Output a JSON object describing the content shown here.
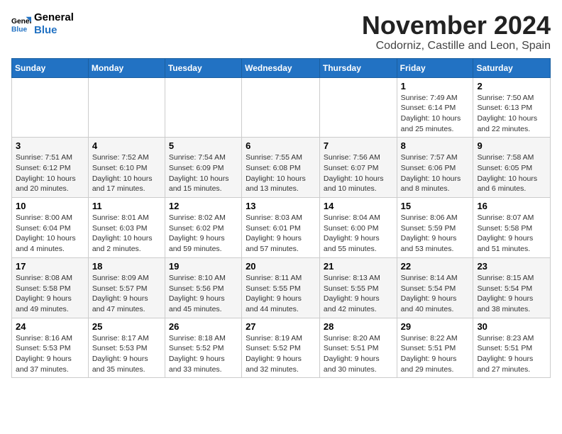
{
  "logo": {
    "line1": "General",
    "line2": "Blue"
  },
  "header": {
    "month_year": "November 2024",
    "location": "Codorniz, Castille and Leon, Spain"
  },
  "days_of_week": [
    "Sunday",
    "Monday",
    "Tuesday",
    "Wednesday",
    "Thursday",
    "Friday",
    "Saturday"
  ],
  "weeks": [
    [
      {
        "day": "",
        "info": ""
      },
      {
        "day": "",
        "info": ""
      },
      {
        "day": "",
        "info": ""
      },
      {
        "day": "",
        "info": ""
      },
      {
        "day": "",
        "info": ""
      },
      {
        "day": "1",
        "info": "Sunrise: 7:49 AM\nSunset: 6:14 PM\nDaylight: 10 hours and 25 minutes."
      },
      {
        "day": "2",
        "info": "Sunrise: 7:50 AM\nSunset: 6:13 PM\nDaylight: 10 hours and 22 minutes."
      }
    ],
    [
      {
        "day": "3",
        "info": "Sunrise: 7:51 AM\nSunset: 6:12 PM\nDaylight: 10 hours and 20 minutes."
      },
      {
        "day": "4",
        "info": "Sunrise: 7:52 AM\nSunset: 6:10 PM\nDaylight: 10 hours and 17 minutes."
      },
      {
        "day": "5",
        "info": "Sunrise: 7:54 AM\nSunset: 6:09 PM\nDaylight: 10 hours and 15 minutes."
      },
      {
        "day": "6",
        "info": "Sunrise: 7:55 AM\nSunset: 6:08 PM\nDaylight: 10 hours and 13 minutes."
      },
      {
        "day": "7",
        "info": "Sunrise: 7:56 AM\nSunset: 6:07 PM\nDaylight: 10 hours and 10 minutes."
      },
      {
        "day": "8",
        "info": "Sunrise: 7:57 AM\nSunset: 6:06 PM\nDaylight: 10 hours and 8 minutes."
      },
      {
        "day": "9",
        "info": "Sunrise: 7:58 AM\nSunset: 6:05 PM\nDaylight: 10 hours and 6 minutes."
      }
    ],
    [
      {
        "day": "10",
        "info": "Sunrise: 8:00 AM\nSunset: 6:04 PM\nDaylight: 10 hours and 4 minutes."
      },
      {
        "day": "11",
        "info": "Sunrise: 8:01 AM\nSunset: 6:03 PM\nDaylight: 10 hours and 2 minutes."
      },
      {
        "day": "12",
        "info": "Sunrise: 8:02 AM\nSunset: 6:02 PM\nDaylight: 9 hours and 59 minutes."
      },
      {
        "day": "13",
        "info": "Sunrise: 8:03 AM\nSunset: 6:01 PM\nDaylight: 9 hours and 57 minutes."
      },
      {
        "day": "14",
        "info": "Sunrise: 8:04 AM\nSunset: 6:00 PM\nDaylight: 9 hours and 55 minutes."
      },
      {
        "day": "15",
        "info": "Sunrise: 8:06 AM\nSunset: 5:59 PM\nDaylight: 9 hours and 53 minutes."
      },
      {
        "day": "16",
        "info": "Sunrise: 8:07 AM\nSunset: 5:58 PM\nDaylight: 9 hours and 51 minutes."
      }
    ],
    [
      {
        "day": "17",
        "info": "Sunrise: 8:08 AM\nSunset: 5:58 PM\nDaylight: 9 hours and 49 minutes."
      },
      {
        "day": "18",
        "info": "Sunrise: 8:09 AM\nSunset: 5:57 PM\nDaylight: 9 hours and 47 minutes."
      },
      {
        "day": "19",
        "info": "Sunrise: 8:10 AM\nSunset: 5:56 PM\nDaylight: 9 hours and 45 minutes."
      },
      {
        "day": "20",
        "info": "Sunrise: 8:11 AM\nSunset: 5:55 PM\nDaylight: 9 hours and 44 minutes."
      },
      {
        "day": "21",
        "info": "Sunrise: 8:13 AM\nSunset: 5:55 PM\nDaylight: 9 hours and 42 minutes."
      },
      {
        "day": "22",
        "info": "Sunrise: 8:14 AM\nSunset: 5:54 PM\nDaylight: 9 hours and 40 minutes."
      },
      {
        "day": "23",
        "info": "Sunrise: 8:15 AM\nSunset: 5:54 PM\nDaylight: 9 hours and 38 minutes."
      }
    ],
    [
      {
        "day": "24",
        "info": "Sunrise: 8:16 AM\nSunset: 5:53 PM\nDaylight: 9 hours and 37 minutes."
      },
      {
        "day": "25",
        "info": "Sunrise: 8:17 AM\nSunset: 5:53 PM\nDaylight: 9 hours and 35 minutes."
      },
      {
        "day": "26",
        "info": "Sunrise: 8:18 AM\nSunset: 5:52 PM\nDaylight: 9 hours and 33 minutes."
      },
      {
        "day": "27",
        "info": "Sunrise: 8:19 AM\nSunset: 5:52 PM\nDaylight: 9 hours and 32 minutes."
      },
      {
        "day": "28",
        "info": "Sunrise: 8:20 AM\nSunset: 5:51 PM\nDaylight: 9 hours and 30 minutes."
      },
      {
        "day": "29",
        "info": "Sunrise: 8:22 AM\nSunset: 5:51 PM\nDaylight: 9 hours and 29 minutes."
      },
      {
        "day": "30",
        "info": "Sunrise: 8:23 AM\nSunset: 5:51 PM\nDaylight: 9 hours and 27 minutes."
      }
    ]
  ]
}
